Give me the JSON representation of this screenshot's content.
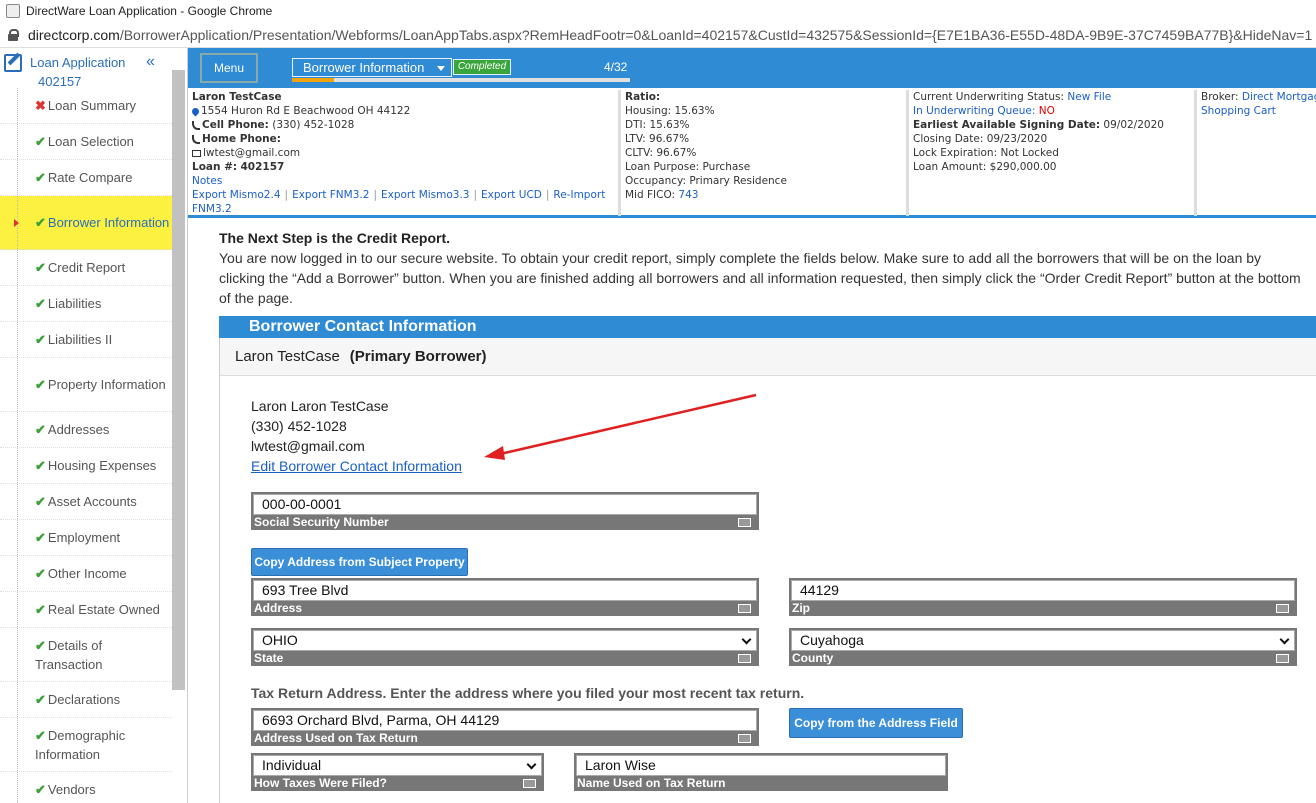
{
  "browser": {
    "title": "DirectWare Loan Application - Google Chrome",
    "url_host": "directcorp.com",
    "url_path": "/BorrowerApplication/Presentation/Webforms/LoanAppTabs.aspx?RemHeadFootr=0&LoanId=402157&CustId=432575&SessionId={E7E1BA36-E55D-48DA-9B9E-37C7459BA77B}&HideNav=1"
  },
  "sidebar": {
    "title": "Loan Application",
    "loan_number": "402157",
    "collapse_icon": "«",
    "items": [
      {
        "label": "Loan Summary",
        "status": "incomplete"
      },
      {
        "label": "Loan Selection",
        "status": "complete"
      },
      {
        "label": "Rate Compare",
        "status": "complete"
      },
      {
        "label": "Borrower Information",
        "status": "complete",
        "active": true
      },
      {
        "label": "Credit Report",
        "status": "complete"
      },
      {
        "label": "Liabilities",
        "status": "complete"
      },
      {
        "label": "Liabilities II",
        "status": "complete"
      },
      {
        "label": "Property Information",
        "status": "complete"
      },
      {
        "label": "Addresses",
        "status": "complete"
      },
      {
        "label": "Housing Expenses",
        "status": "complete"
      },
      {
        "label": "Asset Accounts",
        "status": "complete"
      },
      {
        "label": "Employment",
        "status": "complete"
      },
      {
        "label": "Other Income",
        "status": "complete"
      },
      {
        "label": "Real Estate Owned",
        "status": "complete"
      },
      {
        "label": "Details of Transaction",
        "status": "complete"
      },
      {
        "label": "Declarations",
        "status": "complete"
      },
      {
        "label": "Demographic Information",
        "status": "complete"
      },
      {
        "label": "Vendors",
        "status": "complete"
      }
    ]
  },
  "topbar": {
    "menu_label": "Menu",
    "step_select": "Borrower Information",
    "status_badge": "Completed",
    "step_count": "4/32",
    "progress_fraction": 0.125
  },
  "info": {
    "borrower_name": "Laron TestCase",
    "address": "1554 Huron Rd E Beachwood OH 44122",
    "cell_label": "Cell Phone:",
    "cell_value": "(330) 452-1028",
    "home_label": "Home Phone:",
    "email": "lwtest@gmail.com",
    "loan_label": "Loan #:",
    "loan_value": "402157",
    "notes_link": "Notes",
    "export_links": [
      "Export Mismo2.4",
      "Export FNM3.2",
      "Export Mismo3.3",
      "Export UCD",
      "Re-Import FNM3.2"
    ],
    "ratio_title": "Ratio:",
    "housing": "Housing: 15.63%",
    "dti": "DTI: 15.63%",
    "ltv": "LTV: 96.67%",
    "cltv": "CLTV: 96.67%",
    "loan_purpose": "Loan Purpose: Purchase",
    "occupancy": "Occupancy: Primary Residence",
    "mid_fico_label": "Mid FICO:",
    "mid_fico_value": "743",
    "uw_status_label": "Current Underwriting Status:",
    "uw_status_value": "New File",
    "uw_queue_label": "In Underwriting Queue:",
    "uw_queue_value": "NO",
    "signing_label": "Earliest Available Signing Date:",
    "signing_value": "09/02/2020",
    "closing_date": "Closing Date: 09/23/2020",
    "lock_expiration": "Lock Expiration: Not Locked",
    "loan_amount": "Loan Amount: $290,000.00",
    "broker_label": "Broker:",
    "broker_value": "Direct Mortgage",
    "shopping_cart": "Shopping Cart"
  },
  "content": {
    "heading": "The Next Step is the Credit Report.",
    "intro": "You are now logged in to our secure website. To obtain your credit report, simply complete the fields below. Make sure to add all the borrowers that will be on the loan by clicking the “Add a Borrower” button. When you are finished adding all borrowers and all information requested, then simply click the “Order Credit Report” button at the bottom of the page.",
    "section_title": "Borrower Contact Information",
    "borrower_name": "Laron TestCase",
    "borrower_role": "(Primary Borrower)",
    "contact_name": "Laron Laron TestCase",
    "contact_phone": "(330) 452-1028",
    "contact_email": "lwtest@gmail.com",
    "edit_link": "Edit Borrower Contact Information",
    "ssn_value": "000-00-0001",
    "ssn_label": "Social Security Number",
    "copy_subject_btn": "Copy Address from Subject Property",
    "address_value": "693 Tree Blvd",
    "address_label": "Address",
    "zip_value": "44129",
    "zip_label": "Zip",
    "state_value": "OHIO",
    "state_label": "State",
    "county_value": "Cuyahoga",
    "county_label": "County",
    "tax_heading": "Tax Return Address. Enter the address where you filed your most recent tax return.",
    "tax_address_value": "6693 Orchard Blvd, Parma, OH 44129",
    "tax_address_label": "Address Used on Tax Return",
    "copy_address_btn": "Copy from the Address Field",
    "taxes_filed_value": "Individual",
    "taxes_filed_label": "How Taxes Were Filed?",
    "tax_name_value": "Laron Wise",
    "tax_name_label": "Name Used on Tax Return"
  },
  "colors": {
    "accent_blue": "#2f8bd3",
    "active_yellow": "#fcf141",
    "check_green": "#3aa03a",
    "annotation_red": "#e02020"
  }
}
